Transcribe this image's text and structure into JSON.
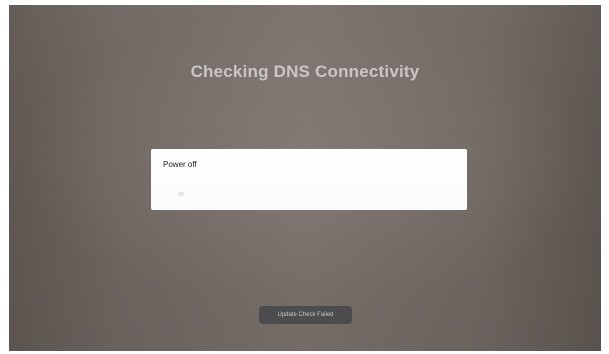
{
  "screen": {
    "title": "Checking DNS Connectivity"
  },
  "dialog": {
    "option_label": "Power off",
    "indicator_icon": "loading-indicator"
  },
  "toast": {
    "message": "Update Check Failed"
  },
  "colors": {
    "background": "#6e6661",
    "title_text": "#c9c5c3",
    "dialog_background": "#ffffff",
    "toast_background": "#4f4e50",
    "toast_text": "#d2d0d2"
  }
}
